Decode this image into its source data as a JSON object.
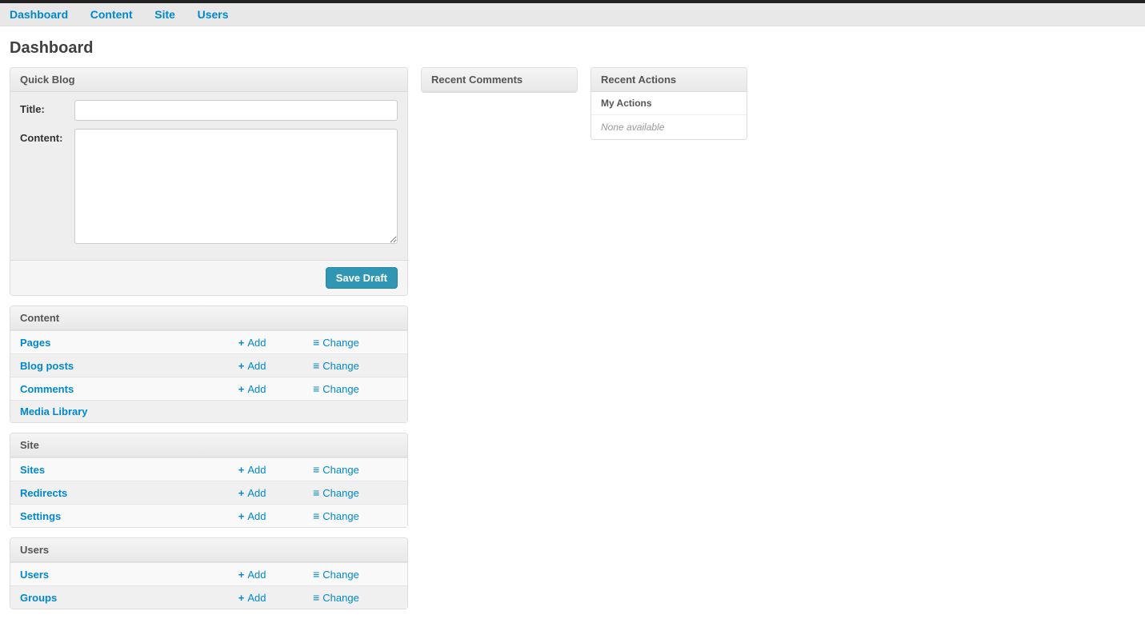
{
  "nav": {
    "dashboard": "Dashboard",
    "content": "Content",
    "site": "Site",
    "users": "Users"
  },
  "page_title": "Dashboard",
  "quick_blog": {
    "header": "Quick Blog",
    "title_label": "Title:",
    "title_value": "",
    "content_label": "Content:",
    "content_value": "",
    "save_draft": "Save Draft"
  },
  "sections": {
    "content": {
      "header": "Content",
      "rows": [
        {
          "name": "Pages",
          "add": "Add",
          "change": "Change"
        },
        {
          "name": "Blog posts",
          "add": "Add",
          "change": "Change"
        },
        {
          "name": "Comments",
          "add": "Add",
          "change": "Change"
        },
        {
          "name": "Media Library"
        }
      ]
    },
    "site": {
      "header": "Site",
      "rows": [
        {
          "name": "Sites",
          "add": "Add",
          "change": "Change"
        },
        {
          "name": "Redirects",
          "add": "Add",
          "change": "Change"
        },
        {
          "name": "Settings",
          "add": "Add",
          "change": "Change"
        }
      ]
    },
    "users": {
      "header": "Users",
      "rows": [
        {
          "name": "Users",
          "add": "Add",
          "change": "Change"
        },
        {
          "name": "Groups",
          "add": "Add",
          "change": "Change"
        }
      ]
    }
  },
  "recent_comments": {
    "header": "Recent Comments"
  },
  "recent_actions": {
    "header": "Recent Actions",
    "subheader": "My Actions",
    "none": "None available"
  }
}
